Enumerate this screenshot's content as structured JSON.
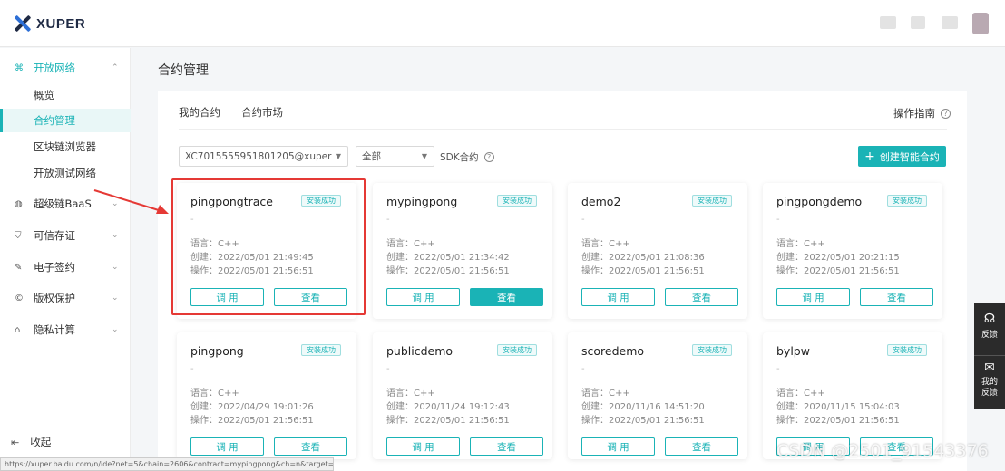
{
  "brand": {
    "name": "XUPER"
  },
  "sidebar": {
    "groups": [
      {
        "label": "开放网络",
        "icon": "network-icon"
      },
      {
        "label": "超级链BaaS",
        "icon": "baas-icon"
      },
      {
        "label": "可信存证",
        "icon": "shield-icon"
      },
      {
        "label": "电子签约",
        "icon": "sign-icon"
      },
      {
        "label": "版权保护",
        "icon": "copyright-icon"
      },
      {
        "label": "隐私计算",
        "icon": "lock-icon"
      }
    ],
    "subitems": [
      {
        "label": "概览"
      },
      {
        "label": "合约管理"
      },
      {
        "label": "区块链浏览器"
      },
      {
        "label": "开放测试网络"
      }
    ],
    "collapse_label": "收起"
  },
  "page": {
    "title": "合约管理"
  },
  "tabs": [
    {
      "label": "我的合约"
    },
    {
      "label": "合约市场"
    }
  ],
  "guide_label": "操作指南",
  "filters": {
    "account": "XC7015555951801205@xuper",
    "status": "全部",
    "sdk_label": "SDK合约"
  },
  "create_button": {
    "label": "创建智能合约"
  },
  "contracts": [
    {
      "name": "pingpongtrace",
      "badge": "安装成功",
      "desc": "-",
      "lang": "语言：C++",
      "created": "创建：2022/05/01 21:49:45",
      "operated": "操作：2022/05/01 21:56:51",
      "call": "调 用",
      "view": "查看"
    },
    {
      "name": "mypingpong",
      "badge": "安装成功",
      "desc": "-",
      "lang": "语言：C++",
      "created": "创建：2022/05/01 21:34:42",
      "operated": "操作：2022/05/01 21:56:51",
      "call": "调 用",
      "view": "查看"
    },
    {
      "name": "demo2",
      "badge": "安装成功",
      "desc": "-",
      "lang": "语言：C++",
      "created": "创建：2022/05/01 21:08:36",
      "operated": "操作：2022/05/01 21:56:51",
      "call": "调 用",
      "view": "查看"
    },
    {
      "name": "pingpongdemo",
      "badge": "安装成功",
      "desc": "-",
      "lang": "语言：C++",
      "created": "创建：2022/05/01 20:21:15",
      "operated": "操作：2022/05/01 21:56:51",
      "call": "调 用",
      "view": "查看"
    },
    {
      "name": "pingpong",
      "badge": "安装成功",
      "desc": "-",
      "lang": "语言：C++",
      "created": "创建：2022/04/29 19:01:26",
      "operated": "操作：2022/05/01 21:56:51",
      "call": "调 用",
      "view": "查看"
    },
    {
      "name": "publicdemo",
      "badge": "安装成功",
      "desc": "-",
      "lang": "语言：C++",
      "created": "创建：2020/11/24 19:12:43",
      "operated": "操作：2022/05/01 21:56:51",
      "call": "调 用",
      "view": "查看"
    },
    {
      "name": "scoredemo",
      "badge": "安装成功",
      "desc": "-",
      "lang": "语言：C++",
      "created": "创建：2020/11/16 14:51:20",
      "operated": "操作：2022/05/01 21:56:51",
      "call": "调 用",
      "view": "查看"
    },
    {
      "name": "bylpw",
      "badge": "安装成功",
      "desc": "-",
      "lang": "语言：C++",
      "created": "创建：2020/11/15 15:04:03",
      "operated": "操作：2022/05/01 21:56:51",
      "call": "调 用",
      "view": "查看"
    }
  ],
  "float_bar": {
    "feedback": "反馈",
    "my_feedback": "我的反馈"
  },
  "status_url": "https://xuper.baidu.com/n/ide?net=5&chain=2606&contract=mypingpong&ch=n&target=_...",
  "watermark": "CSDN @2501_91543376",
  "colors": {
    "accent": "#1ab3b6",
    "highlight": "#e53935"
  }
}
